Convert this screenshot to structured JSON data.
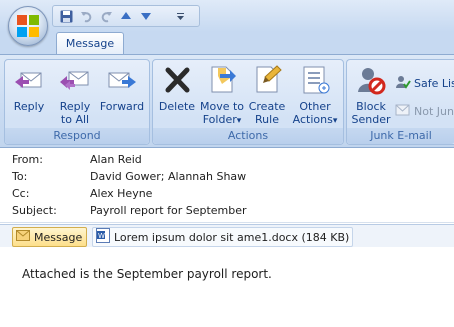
{
  "window": {
    "tab_label": "Message"
  },
  "quick_access": {
    "icons": [
      "save-icon",
      "undo-icon",
      "redo-icon",
      "up-arrow-icon",
      "down-arrow-icon",
      "customize-dropdown-icon"
    ]
  },
  "ribbon": {
    "groups": {
      "respond": {
        "label": "Respond",
        "buttons": {
          "reply": "Reply",
          "reply_all": "Reply\nto All",
          "forward": "Forward"
        }
      },
      "actions": {
        "label": "Actions",
        "buttons": {
          "delete": "Delete",
          "move_to_folder": "Move to\nFolder",
          "create_rule": "Create\nRule",
          "other_actions": "Other\nActions"
        }
      },
      "junk": {
        "label": "Junk E-mail",
        "buttons": {
          "block_sender": "Block\nSender",
          "safe_list": "Safe List",
          "not_junk": "Not Junk"
        }
      }
    },
    "dropdown_arrow": "▾"
  },
  "headers": {
    "from_label": "From:",
    "from_value": "Alan Reid",
    "to_label": "To:",
    "to_value": "David Gower; Alannah Shaw",
    "cc_label": "Cc:",
    "cc_value": "Alex Heyne",
    "subject_label": "Subject:",
    "subject_value": "Payroll report for September"
  },
  "attachments": {
    "message_tab": "Message",
    "file": "Lorem ipsum dolor sit ame1.docx (184 KB)"
  },
  "body": {
    "text": "Attached is the September payroll report."
  },
  "colors": {
    "ribbon_text": "#15428b",
    "group_label": "#3e6aaa",
    "accent": "#c6d9f1"
  }
}
